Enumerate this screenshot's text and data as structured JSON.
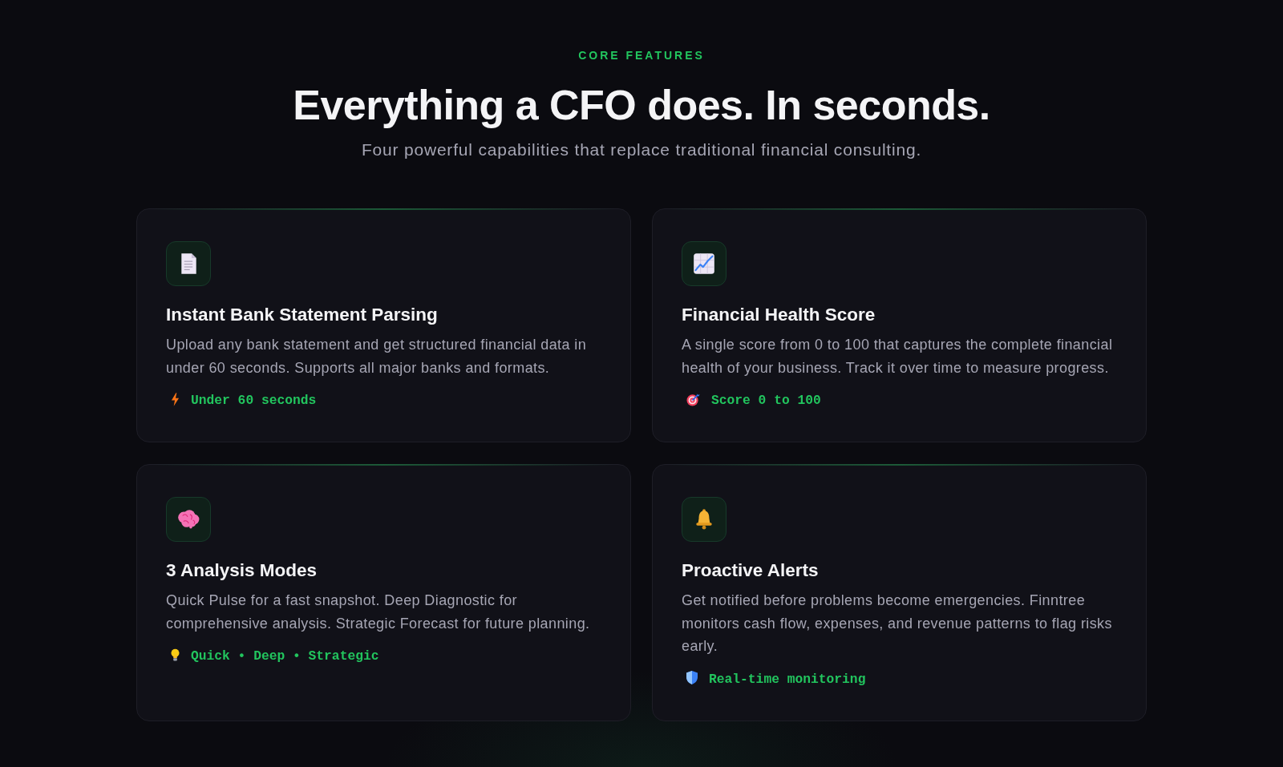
{
  "section": {
    "eyebrow": "CORE FEATURES",
    "title": "Everything a CFO does. In seconds.",
    "subtitle": "Four powerful capabilities that replace traditional financial consulting."
  },
  "features": [
    {
      "title": "Instant Bank Statement Parsing",
      "description": "Upload any bank statement and get structured financial data in under 60 seconds. Supports all major banks and formats.",
      "tag": "Under 60 seconds"
    },
    {
      "title": "Financial Health Score",
      "description": "A single score from 0 to 100 that captures the complete financial health of your business. Track it over time to measure progress.",
      "tag": "Score 0 to 100"
    },
    {
      "title": "3 Analysis Modes",
      "description": "Quick Pulse for a fast snapshot. Deep Diagnostic for comprehensive analysis. Strategic Forecast for future planning.",
      "tag": "Quick • Deep • Strategic"
    },
    {
      "title": "Proactive Alerts",
      "description": "Get notified before problems become emergencies. Finntree monitors cash flow, expenses, and revenue patterns to flag risks early.",
      "tag": "Real-time monitoring"
    }
  ]
}
